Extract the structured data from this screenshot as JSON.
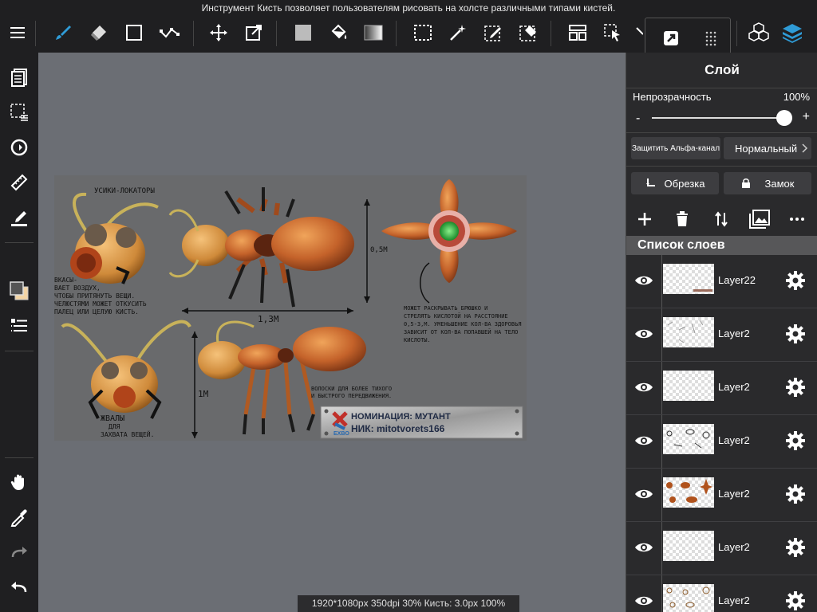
{
  "app": {
    "hint": "Инструмент Кисть позволяет пользователям рисовать на холсте различными типами кистей.",
    "status": "1920*1080px 350dpi 30% Кисть: 3.0px 100%"
  },
  "toolbar": {
    "icons": [
      "menu-icon",
      "brush-icon",
      "eraser-icon",
      "shape-icon",
      "vector-icon",
      "move-icon",
      "transform-icon",
      "fill-color-icon",
      "bucket-icon",
      "gradient-icon",
      "select-rect-icon",
      "magic-wand-icon",
      "select-pen-icon",
      "select-eraser-icon",
      "layout-icon",
      "select-arrow-icon",
      "snap-icon",
      "grid-icon",
      "3d-icon",
      "layers-icon"
    ]
  },
  "leftbar": {
    "icons": [
      "pages-icon",
      "selection-icon",
      "rotate-icon",
      "ruler-icon",
      "fill-pen-icon",
      "color-icon",
      "layer-list-icon",
      "hand-icon",
      "eyedropper-icon",
      "redo-icon",
      "undo-icon"
    ]
  },
  "artwork": {
    "label_antennae": "УСИКИ-ЛОКАТОРЫ",
    "label_head_notes": [
      "ВКАСЫ-",
      "ВАЕТ ВОЗДУХ,",
      "ЧТОБЫ ПРИТЯНУТЬ ВЕЩИ.",
      "ЧЕЛЮСТЯМИ МОЖЕТ ОТКУСИТЬ",
      "ПАЛЕЦ ИЛИ ЦЕЛУЮ КИСТЬ."
    ],
    "label_width": "1,3М",
    "label_height_small": "0,5М",
    "label_height_big": "1М",
    "label_belly": [
      "МОЖЕТ РАСКРЫВАТЬ БРЮШКО И",
      "СТРЕЛЯТЬ КИСЛОТОЙ НА РАССТОЯНИЕ",
      "0,5-3,М. УМЕНЬШЕНИЕ КОЛ-ВА ЗДОРОВЬЯ",
      "ЗАВИСИТ ОТ КОЛ-ВА ПОПАВШЕЙ НА ТЕЛО",
      "КИСЛОТЫ."
    ],
    "label_jaws": [
      "ЖВАЛЫ",
      "ДЛЯ",
      "ЗАХВАТА ВЕЩЕЙ."
    ],
    "label_hairs": [
      "ВОЛОСКИ ДЛЯ БОЛЕЕ ТИХОГО",
      "И БЫСТРОГО ПЕРЕДВИЖЕНИЯ."
    ],
    "plate_logo": "EXBO",
    "plate_line1": "НОМИНАЦИЯ: МУТАНТ",
    "plate_line2": "НИК: mitotvorets166"
  },
  "panel": {
    "title": "Слой",
    "opacity_label": "Непрозрачность",
    "opacity_value": "100%",
    "opacity_fraction": 1.0,
    "protect_alpha": "Защитить Альфа-канал",
    "blend_mode": "Нормальный",
    "clip_label": "Обрезка",
    "lock_label": "Замок",
    "list_header": "Список слоев",
    "layers": [
      {
        "name": "Layer22"
      },
      {
        "name": "Layer2"
      },
      {
        "name": "Layer2"
      },
      {
        "name": "Layer2"
      },
      {
        "name": "Layer2"
      },
      {
        "name": "Layer2"
      },
      {
        "name": "Layer2"
      }
    ]
  },
  "colors": {
    "accent": "#2f9bd6",
    "toolbar_bg": "#1f1f21",
    "canvas_bg": "#6b6e74",
    "panel_bg": "#2a2a2c"
  }
}
